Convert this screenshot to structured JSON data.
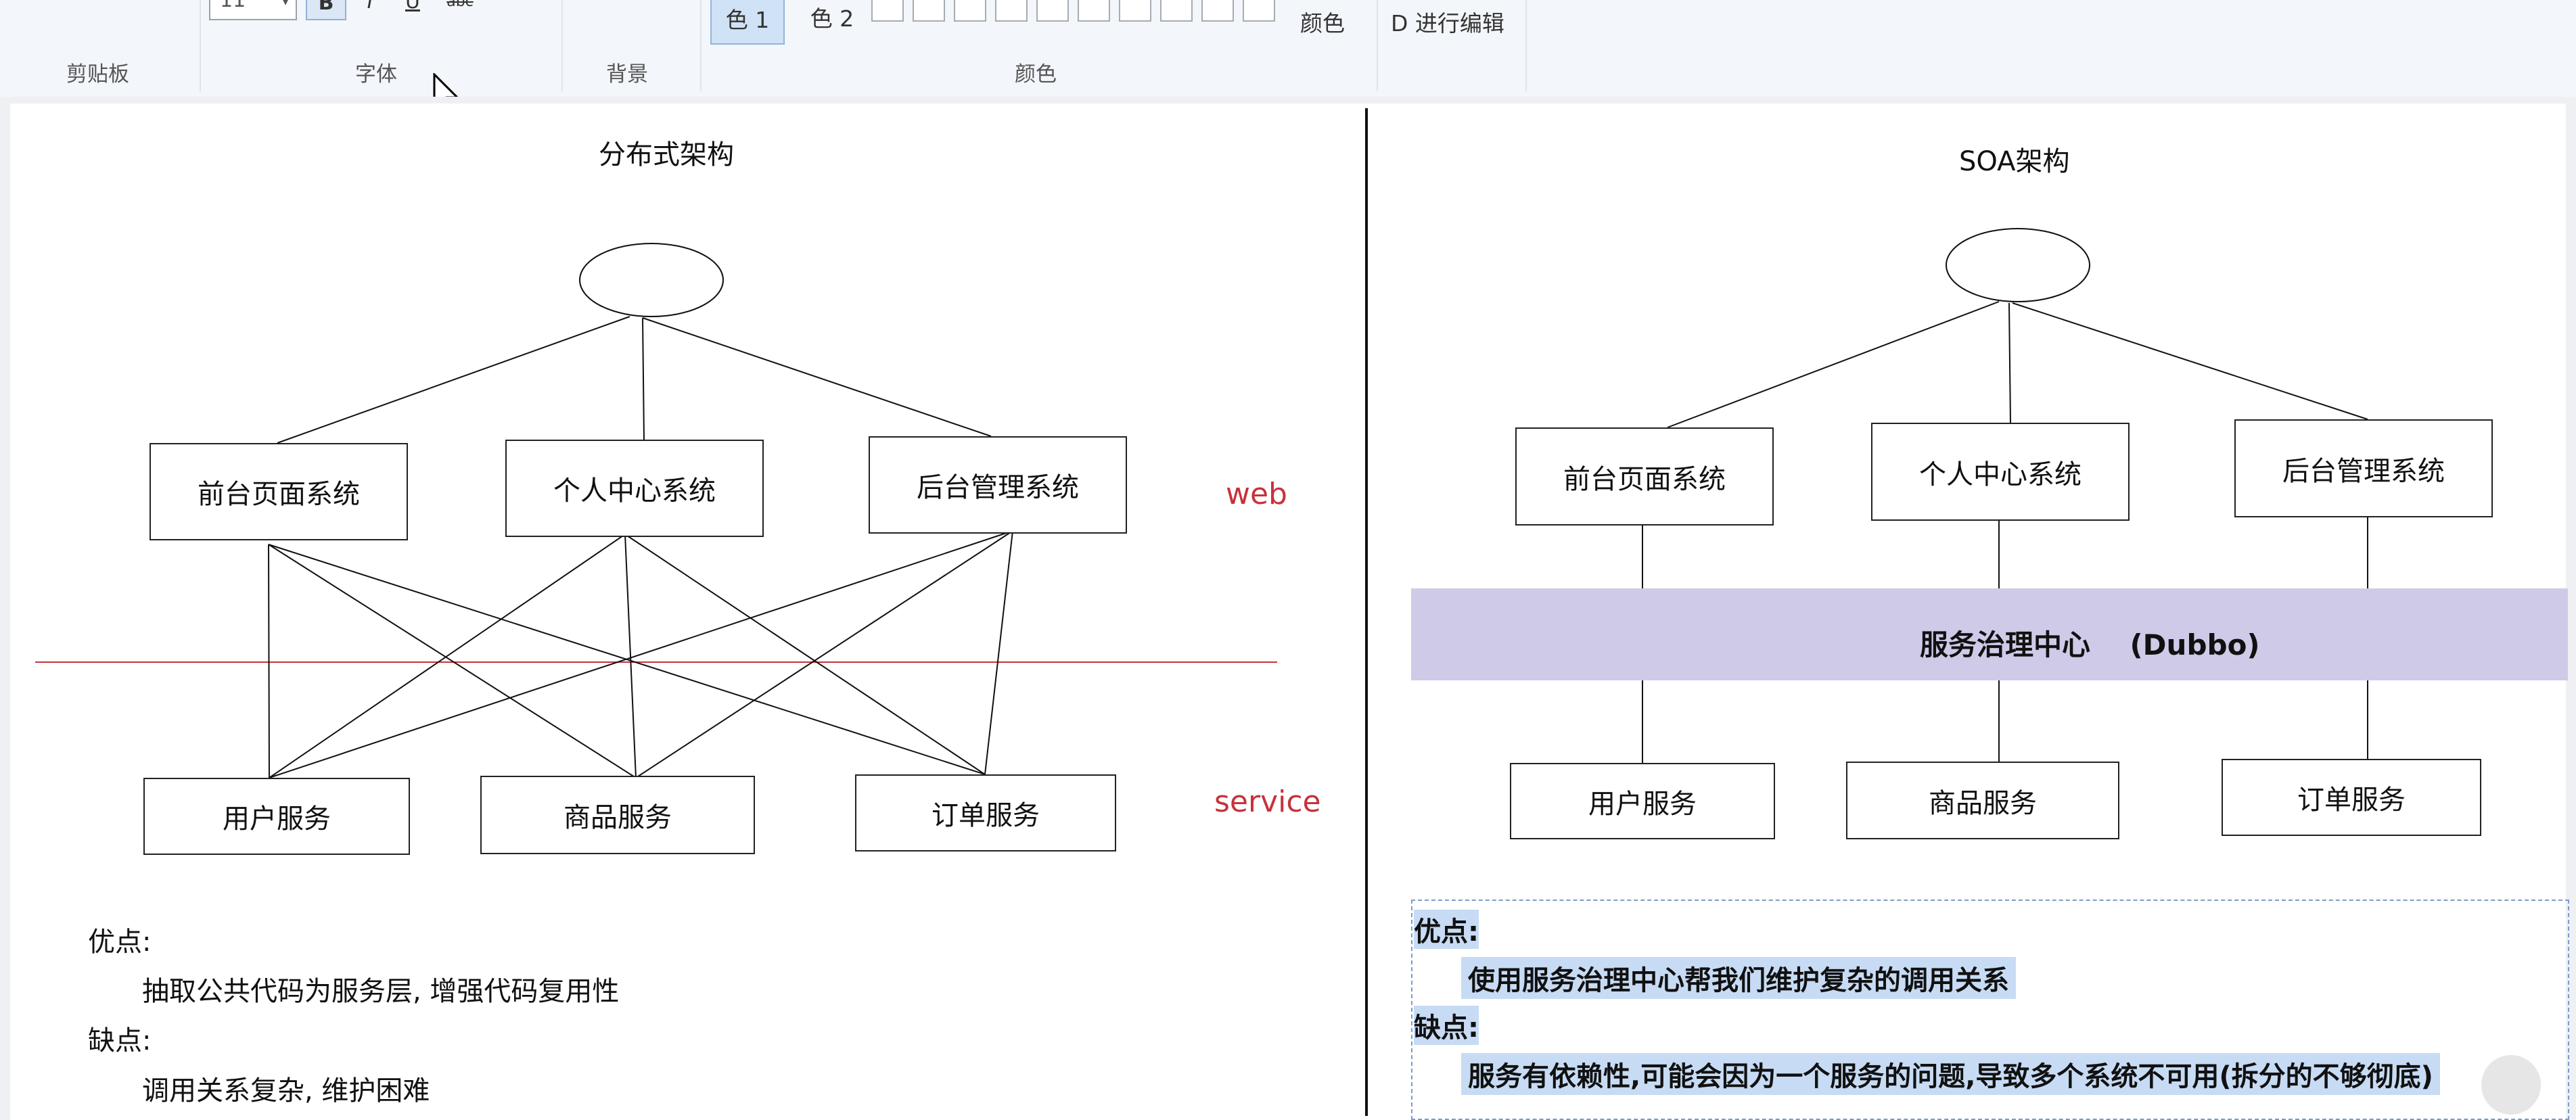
{
  "ribbon": {
    "groups": {
      "clipboard": "剪贴板",
      "font": "字体",
      "background": "背景",
      "colors": "颜色"
    },
    "font_size": "11",
    "format_buttons": {
      "bold": "B",
      "italic": "I",
      "underline": "U",
      "strike": "abc"
    },
    "color1": "色 1",
    "color2": "色 2",
    "color_label": "颜色",
    "edit_colors": "D 进行编辑"
  },
  "left_diagram": {
    "title": "分布式架构",
    "web_label": "web",
    "service_label": "service",
    "web_boxes": [
      "前台页面系统",
      "个人中心系统",
      "后台管理系统"
    ],
    "service_boxes": [
      "用户服务",
      "商品服务",
      "订单服务"
    ],
    "pros_title": "优点:",
    "pros_text": "抽取公共代码为服务层, 增强代码复用性",
    "cons_title": "缺点:",
    "cons_text": "调用关系复杂, 维护困难"
  },
  "right_diagram": {
    "title": "SOA架构",
    "web_boxes": [
      "前台页面系统",
      "个人中心系统",
      "后台管理系统"
    ],
    "middle_label": "服务治理中心    (Dubbo)",
    "service_boxes": [
      "用户服务",
      "商品服务",
      "订单服务"
    ],
    "pros_title": "优点:",
    "pros_text": "使用服务治理中心帮我们维护复杂的调用关系",
    "cons_title": "缺点:",
    "cons_text": "服务有依赖性,可能会因为一个服务的问题,导致多个系统不可用(拆分的不够彻底)"
  },
  "colors": {
    "accent_red": "#c7323b",
    "dubbo_band": "#cfcae8",
    "text_highlight": "#c7dbf4"
  }
}
